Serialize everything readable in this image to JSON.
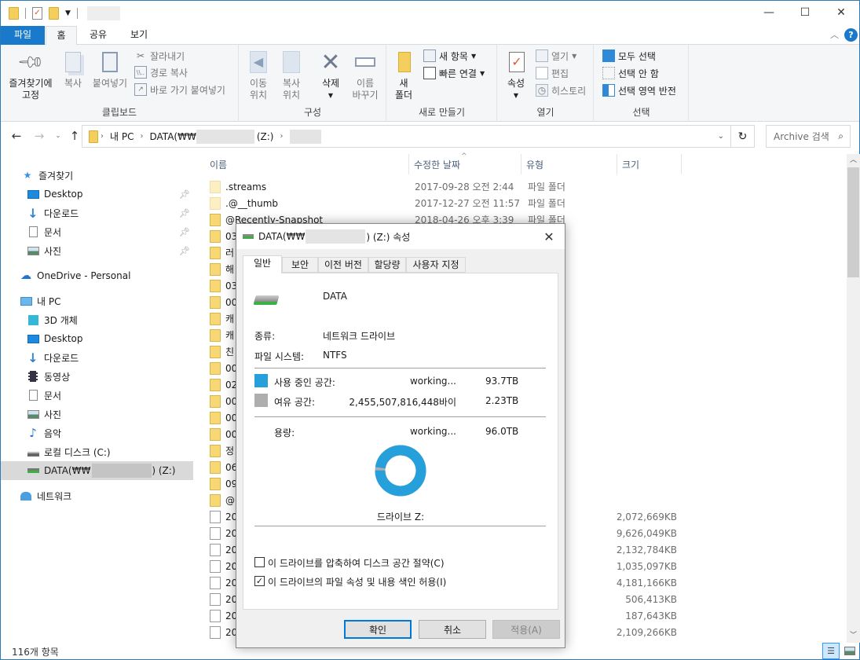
{
  "window": {
    "controls": {
      "minimize": "—",
      "maximize": "☐",
      "close": "✕"
    }
  },
  "ribbon": {
    "tabs": [
      {
        "label": "파일"
      },
      {
        "label": "홈"
      },
      {
        "label": "공유"
      },
      {
        "label": "보기"
      }
    ],
    "active_tab": "홈",
    "groups": {
      "clipboard": {
        "label": "클립보드",
        "pin_to_quick": "즐겨찾기에\n고정",
        "copy": "복사",
        "paste": "붙여넣기",
        "cut": "잘라내기",
        "copy_path": "경로 복사",
        "paste_shortcut": "바로 가기 붙여넣기"
      },
      "organize": {
        "label": "구성",
        "move_to": "이동\n위치",
        "copy_to": "복사\n위치",
        "delete": "삭제",
        "rename": "이름\n바꾸기"
      },
      "new": {
        "label": "새로 만들기",
        "new_folder": "새\n폴더",
        "new_item": "새 항목",
        "easy_access": "빠른 연결"
      },
      "open": {
        "label": "열기",
        "properties": "속성",
        "open": "열기",
        "edit": "편집",
        "history": "히스토리"
      },
      "select": {
        "label": "선택",
        "select_all": "모두 선택",
        "select_none": "선택 안 함",
        "invert": "선택 영역 반전"
      }
    }
  },
  "address": {
    "crumbs": [
      "내 PC",
      "DATA(₩₩",
      "(Z:)"
    ],
    "search_placeholder": "Archive 검색"
  },
  "columns": {
    "name": "이름",
    "modified": "수정한 날짜",
    "type": "유형",
    "size": "크기"
  },
  "nav": {
    "quick_access": "즐겨찾기",
    "quick_items": [
      "Desktop",
      "다운로드",
      "문서",
      "사진"
    ],
    "onedrive": "OneDrive - Personal",
    "this_pc": "내 PC",
    "pc_items": [
      "3D 개체",
      "Desktop",
      "다운로드",
      "동영상",
      "문서",
      "사진",
      "음악",
      "로컬 디스크 (C:)"
    ],
    "data_drive": "DATA(₩₩",
    "data_drive_suffix": ") (Z:)",
    "network": "네트워크"
  },
  "files": [
    {
      "name": ".streams",
      "date": "2017-09-28 오전 2:44",
      "type": "파일 폴더",
      "size": "",
      "kind": "hfolder"
    },
    {
      "name": ".@__thumb",
      "date": "2017-12-27 오전 11:57",
      "type": "파일 폴더",
      "size": "",
      "kind": "hfolder"
    },
    {
      "name": "@Recently-Snapshot",
      "date": "2018-04-26 오후 3:39",
      "type": "파일 폴더",
      "size": "",
      "kind": "folder"
    },
    {
      "name": "03",
      "date": "",
      "type": "",
      "size": "",
      "kind": "folder"
    },
    {
      "name": "러",
      "date": "",
      "type": "",
      "size": "",
      "kind": "folder"
    },
    {
      "name": "해",
      "date": "",
      "type": "",
      "size": "",
      "kind": "folder"
    },
    {
      "name": "03",
      "date": "",
      "type": "",
      "size": "",
      "kind": "folder"
    },
    {
      "name": "00",
      "date": "",
      "type": "",
      "size": "",
      "kind": "folder"
    },
    {
      "name": "캐",
      "date": "",
      "type": "",
      "size": "",
      "kind": "folder"
    },
    {
      "name": "캐",
      "date": "",
      "type": "",
      "size": "",
      "kind": "folder"
    },
    {
      "name": "친",
      "date": "",
      "type": "",
      "size": "",
      "kind": "folder"
    },
    {
      "name": "00",
      "date": "",
      "type": "",
      "size": "",
      "kind": "folder"
    },
    {
      "name": "02",
      "date": "",
      "type": "",
      "size": "",
      "kind": "folder"
    },
    {
      "name": "00",
      "date": "",
      "type": "",
      "size": "",
      "kind": "folder"
    },
    {
      "name": "00",
      "date": "",
      "type": "",
      "size": "",
      "kind": "folder"
    },
    {
      "name": "00",
      "date": "",
      "type": "",
      "size": "",
      "kind": "folder"
    },
    {
      "name": "정",
      "date": "",
      "type": "",
      "size": "",
      "kind": "folder"
    },
    {
      "name": "06",
      "date": "",
      "type": "",
      "size": "",
      "kind": "folder"
    },
    {
      "name": "09",
      "date": "",
      "type": "",
      "size": "",
      "kind": "folder"
    },
    {
      "name": "@",
      "date": "",
      "type": "",
      "size": "",
      "kind": "folder"
    },
    {
      "name": "20",
      "date": "",
      "type": "",
      "size": "2,072,669KB",
      "kind": "file"
    },
    {
      "name": "20",
      "date": "",
      "type": "",
      "size": "9,626,049KB",
      "kind": "file"
    },
    {
      "name": "20",
      "date": "",
      "type": "",
      "size": "2,132,784KB",
      "kind": "file"
    },
    {
      "name": "20",
      "date": "",
      "type": "",
      "size": "1,035,097KB",
      "kind": "file"
    },
    {
      "name": "20",
      "date": "",
      "type": "",
      "size": "4,181,166KB",
      "kind": "file"
    },
    {
      "name": "20",
      "date": "",
      "type": "",
      "size": "506,413KB",
      "kind": "file"
    },
    {
      "name": "20",
      "date": "",
      "type": "",
      "size": "187,643KB",
      "kind": "file"
    },
    {
      "name": "20",
      "date": "",
      "type": "",
      "size": "2,109,266KB",
      "kind": "file"
    }
  ],
  "status": {
    "item_count": "116개 항목"
  },
  "dialog": {
    "title_prefix": "DATA(₩₩",
    "title_suffix": ") (Z:) 속성",
    "close": "✕",
    "tabs": [
      "일반",
      "보안",
      "이전 버전",
      "할당량",
      "사용자 지정"
    ],
    "active_tab": "일반",
    "drive_name": "DATA",
    "type_label": "종류:",
    "type_value": "네트워크 드라이브",
    "fs_label": "파일 시스템:",
    "fs_value": "NTFS",
    "used_label": "사용 중인 공간:",
    "used_bytes": "working...",
    "used_size": "93.7TB",
    "free_label": "여유 공간:",
    "free_bytes": "2,455,507,816,448바이트",
    "free_bytes_shown": "2,455,507,816,448바이",
    "free_size": "2.23TB",
    "capacity_label": "용량:",
    "capacity_bytes": "working...",
    "capacity_size": "96.0TB",
    "used_fraction": 0.977,
    "used_color": "#26a0da",
    "free_color": "#aeaeae",
    "drive_label": "드라이브 Z:",
    "compress_label": "이 드라이브를 압축하여 디스크 공간 절약(C)",
    "compress_checked": false,
    "index_label": "이 드라이브의 파일 속성 및 내용 색인 허용(I)",
    "index_checked": true,
    "ok": "확인",
    "cancel": "취소",
    "apply": "적용(A)"
  }
}
